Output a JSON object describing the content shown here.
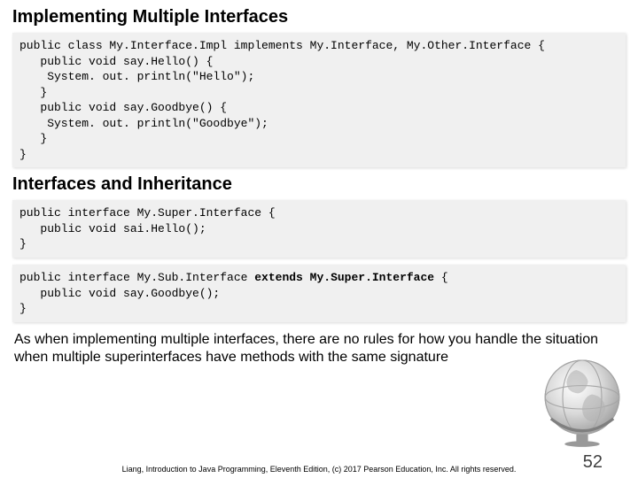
{
  "heading1": "Implementing Multiple Interfaces",
  "code1": "public class My.Interface.Impl implements My.Interface, My.Other.Interface {\n   public void say.Hello() {\n    System. out. println(\"Hello\");\n   }\n   public void say.Goodbye() {\n    System. out. println(\"Goodbye\");\n   }\n}",
  "heading2": "Interfaces and Inheritance",
  "code2": {
    "line1": "public interface My.Super.Interface {",
    "line2": "   public void sai.Hello();",
    "line3": "}"
  },
  "code3": {
    "line1a": "public interface My.Sub.Interface ",
    "kw": "extends",
    "line1b": " My.Super.Interface",
    "line1c": " {",
    "line2": "   public void say.Goodbye();",
    "line3": "}"
  },
  "bodytext": "As when implementing multiple interfaces, there are no rules for how you handle the situation when multiple superinterfaces have methods with the same signature",
  "footer": "Liang, Introduction to Java Programming, Eleventh Edition, (c) 2017 Pearson Education, Inc. All rights reserved.",
  "pagenum": "52"
}
